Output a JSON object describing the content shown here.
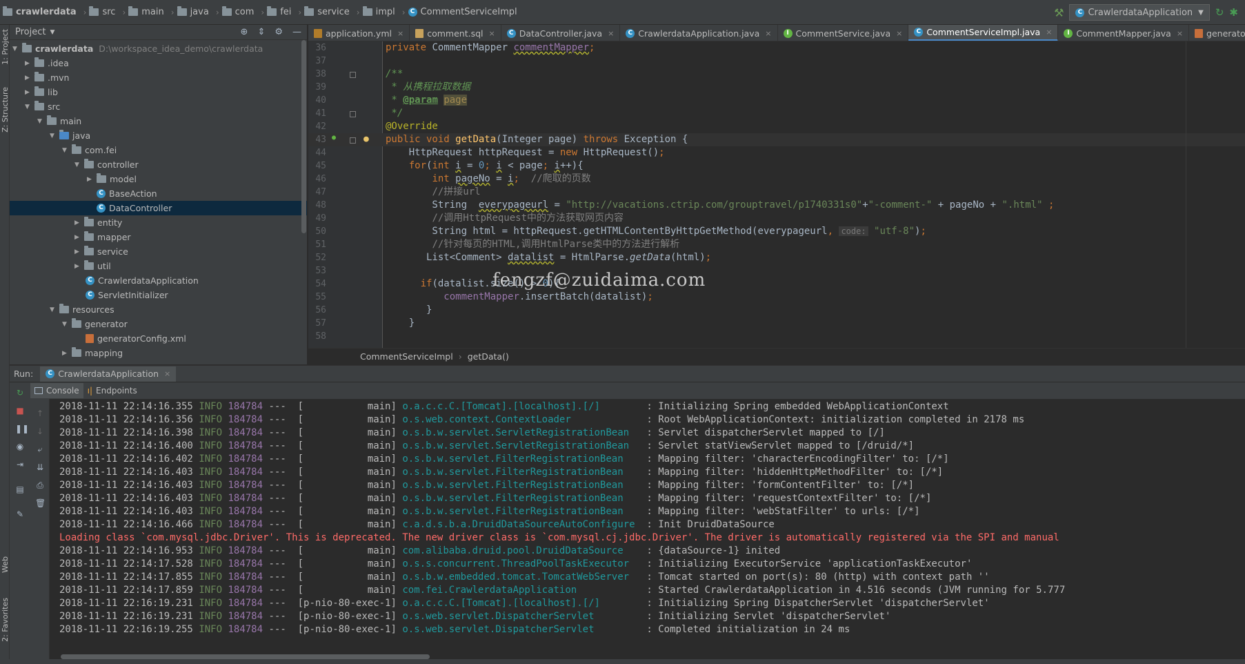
{
  "breadcrumb": {
    "items": [
      "crawlerdata",
      "src",
      "main",
      "java",
      "com",
      "fei",
      "service",
      "impl",
      "CommentServiceImpl"
    ]
  },
  "toolbar": {
    "run_config": "CrawlerdataApplication"
  },
  "left_strip": {
    "project_tab": "1: Project",
    "structure_tab": "Z: Structure",
    "web_tab": "Web",
    "favorites_tab": "2: Favorites"
  },
  "project_panel": {
    "title": "Project",
    "root_name": "crawlerdata",
    "root_path": "D:\\workspace_idea_demo\\crawlerdata",
    "items": [
      {
        "label": ".idea"
      },
      {
        "label": ".mvn"
      },
      {
        "label": "lib"
      },
      {
        "label": "src"
      },
      {
        "label": "main"
      },
      {
        "label": "java"
      },
      {
        "label": "com.fei"
      },
      {
        "label": "controller"
      },
      {
        "label": "model"
      },
      {
        "label": "BaseAction"
      },
      {
        "label": "DataController"
      },
      {
        "label": "entity"
      },
      {
        "label": "mapper"
      },
      {
        "label": "service"
      },
      {
        "label": "util"
      },
      {
        "label": "CrawlerdataApplication"
      },
      {
        "label": "ServletInitializer"
      },
      {
        "label": "resources"
      },
      {
        "label": "generator"
      },
      {
        "label": "generatorConfig.xml"
      },
      {
        "label": "mapping"
      }
    ]
  },
  "editor_tabs": [
    {
      "label": "application.yml"
    },
    {
      "label": "comment.sql"
    },
    {
      "label": "DataController.java"
    },
    {
      "label": "CrawlerdataApplication.java"
    },
    {
      "label": "CommentService.java"
    },
    {
      "label": "CommentServiceImpl.java"
    },
    {
      "label": "CommentMapper.java"
    },
    {
      "label": "generatorConfig.xml"
    }
  ],
  "editor": {
    "line_numbers": [
      "36",
      "37",
      "38",
      "39",
      "40",
      "41",
      "42",
      "43",
      "44",
      "45",
      "46",
      "47",
      "48",
      "49",
      "50",
      "51",
      "52",
      "53",
      "54",
      "55",
      "56",
      "57",
      "58"
    ],
    "watermark": "fengzf@zuidaima.com",
    "inlay_hint": "code:"
  },
  "editor_crumbs": {
    "class": "CommentServiceImpl",
    "method": "getData()"
  },
  "run_panel": {
    "label": "Run:",
    "tab": "CrawlerdataApplication",
    "console_tab": "Console",
    "endpoints_tab": "Endpoints"
  },
  "console": {
    "lines": [
      {
        "ts": "2018-11-11 22:14:16.355",
        "lvl": "INFO",
        "pid": "184784",
        "thread": "---  [           main]",
        "logger": "o.a.c.c.C.[Tomcat].[localhost].[/]       ",
        "msg": ": Initializing Spring embedded WebApplicationContext"
      },
      {
        "ts": "2018-11-11 22:14:16.356",
        "lvl": "INFO",
        "pid": "184784",
        "thread": "---  [           main]",
        "logger": "o.s.web.context.ContextLoader            ",
        "msg": ": Root WebApplicationContext: initialization completed in 2178 ms"
      },
      {
        "ts": "2018-11-11 22:14:16.398",
        "lvl": "INFO",
        "pid": "184784",
        "thread": "---  [           main]",
        "logger": "o.s.b.w.servlet.ServletRegistrationBean  ",
        "msg": ": Servlet dispatcherServlet mapped to [/]"
      },
      {
        "ts": "2018-11-11 22:14:16.400",
        "lvl": "INFO",
        "pid": "184784",
        "thread": "---  [           main]",
        "logger": "o.s.b.w.servlet.ServletRegistrationBean  ",
        "msg": ": Servlet statViewServlet mapped to [/druid/*]"
      },
      {
        "ts": "2018-11-11 22:14:16.402",
        "lvl": "INFO",
        "pid": "184784",
        "thread": "---  [           main]",
        "logger": "o.s.b.w.servlet.FilterRegistrationBean   ",
        "msg": ": Mapping filter: 'characterEncodingFilter' to: [/*]"
      },
      {
        "ts": "2018-11-11 22:14:16.403",
        "lvl": "INFO",
        "pid": "184784",
        "thread": "---  [           main]",
        "logger": "o.s.b.w.servlet.FilterRegistrationBean   ",
        "msg": ": Mapping filter: 'hiddenHttpMethodFilter' to: [/*]"
      },
      {
        "ts": "2018-11-11 22:14:16.403",
        "lvl": "INFO",
        "pid": "184784",
        "thread": "---  [           main]",
        "logger": "o.s.b.w.servlet.FilterRegistrationBean   ",
        "msg": ": Mapping filter: 'formContentFilter' to: [/*]"
      },
      {
        "ts": "2018-11-11 22:14:16.403",
        "lvl": "INFO",
        "pid": "184784",
        "thread": "---  [           main]",
        "logger": "o.s.b.w.servlet.FilterRegistrationBean   ",
        "msg": ": Mapping filter: 'requestContextFilter' to: [/*]"
      },
      {
        "ts": "2018-11-11 22:14:16.403",
        "lvl": "INFO",
        "pid": "184784",
        "thread": "---  [           main]",
        "logger": "o.s.b.w.servlet.FilterRegistrationBean   ",
        "msg": ": Mapping filter: 'webStatFilter' to urls: [/*]"
      },
      {
        "ts": "2018-11-11 22:14:16.466",
        "lvl": "INFO",
        "pid": "184784",
        "thread": "---  [           main]",
        "logger": "c.a.d.s.b.a.DruidDataSourceAutoConfigure ",
        "msg": ": Init DruidDataSource"
      },
      {
        "error": "Loading class `com.mysql.jdbc.Driver'. This is deprecated. The new driver class is `com.mysql.cj.jdbc.Driver'. The driver is automatically registered via the SPI and manual"
      },
      {
        "ts": "2018-11-11 22:14:16.953",
        "lvl": "INFO",
        "pid": "184784",
        "thread": "---  [           main]",
        "logger": "com.alibaba.druid.pool.DruidDataSource   ",
        "msg": ": {dataSource-1} inited"
      },
      {
        "ts": "2018-11-11 22:14:17.528",
        "lvl": "INFO",
        "pid": "184784",
        "thread": "---  [           main]",
        "logger": "o.s.s.concurrent.ThreadPoolTaskExecutor  ",
        "msg": ": Initializing ExecutorService 'applicationTaskExecutor'"
      },
      {
        "ts": "2018-11-11 22:14:17.855",
        "lvl": "INFO",
        "pid": "184784",
        "thread": "---  [           main]",
        "logger": "o.s.b.w.embedded.tomcat.TomcatWebServer  ",
        "msg": ": Tomcat started on port(s): 80 (http) with context path ''"
      },
      {
        "ts": "2018-11-11 22:14:17.859",
        "lvl": "INFO",
        "pid": "184784",
        "thread": "---  [           main]",
        "logger": "com.fei.CrawlerdataApplication           ",
        "msg": ": Started CrawlerdataApplication in 4.516 seconds (JVM running for 5.777"
      },
      {
        "ts": "2018-11-11 22:16:19.231",
        "lvl": "INFO",
        "pid": "184784",
        "thread": "---  [p-nio-80-exec-1]",
        "logger": "o.a.c.c.C.[Tomcat].[localhost].[/]       ",
        "msg": ": Initializing Spring DispatcherServlet 'dispatcherServlet'"
      },
      {
        "ts": "2018-11-11 22:16:19.231",
        "lvl": "INFO",
        "pid": "184784",
        "thread": "---  [p-nio-80-exec-1]",
        "logger": "o.s.web.servlet.DispatcherServlet        ",
        "msg": ": Initializing Servlet 'dispatcherServlet'"
      },
      {
        "ts": "2018-11-11 22:16:19.255",
        "lvl": "INFO",
        "pid": "184784",
        "thread": "---  [p-nio-80-exec-1]",
        "logger": "o.s.web.servlet.DispatcherServlet        ",
        "msg": ": Completed initialization in 24 ms"
      }
    ]
  },
  "colors": {
    "background": "#2b2b2b",
    "panel": "#3c3f41",
    "selection": "#0d293e",
    "accent": "#4a88c7",
    "error_text": "#ff6b68"
  }
}
